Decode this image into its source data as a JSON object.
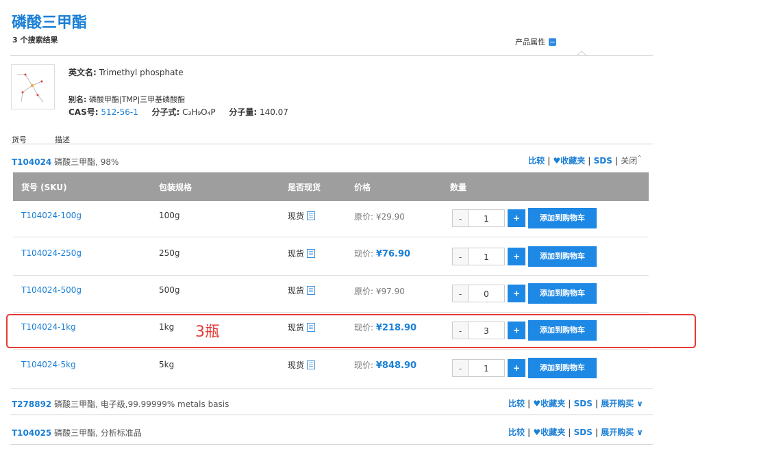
{
  "header": {
    "title": "磷酸三甲酯",
    "result_count": "3 个搜索结果",
    "attr_toggle_label": "产品属性"
  },
  "compound": {
    "english_label": "英文名:",
    "english_name": "Trimethyl phosphate",
    "alias_label": "别名:",
    "alias": "磷酸甲酯|TMP|三甲基磷酸酯",
    "cas_label": "CAS号:",
    "cas": "512-56-1",
    "formula_label": "分子式:",
    "formula": "C₃H₉O₄P",
    "mw_label": "分子量:",
    "mw": "140.07"
  },
  "list_header": {
    "sku": "货号",
    "desc": "描述"
  },
  "products": [
    {
      "code": "T104024",
      "desc": "磷酸三甲酯, 98%",
      "compare": "比较",
      "favorite": "收藏夹",
      "sds": "SDS",
      "toggle": "关闭"
    },
    {
      "code": "T278892",
      "desc": "磷酸三甲酯, 电子级,99.99999% metals basis",
      "compare": "比较",
      "favorite": "收藏夹",
      "sds": "SDS",
      "toggle": "展开购买"
    },
    {
      "code": "T104025",
      "desc": "磷酸三甲酯, 分析标准品",
      "compare": "比较",
      "favorite": "收藏夹",
      "sds": "SDS",
      "toggle": "展开购买"
    }
  ],
  "sku_table": {
    "columns": [
      "货号 (SKU)",
      "包装规格",
      "是否现货",
      "价格",
      "数量"
    ],
    "rows": [
      {
        "sku": "T104024-100g",
        "spec": "100g",
        "stock": "现货",
        "price_label": "原价:",
        "price": "¥29.90",
        "qty": "1",
        "cart": "添加到购物车"
      },
      {
        "sku": "T104024-250g",
        "spec": "250g",
        "stock": "现货",
        "price_label": "现价:",
        "price": "¥76.90",
        "qty": "1",
        "cart": "添加到购物车"
      },
      {
        "sku": "T104024-500g",
        "spec": "500g",
        "stock": "现货",
        "price_label": "原价:",
        "price": "¥97.90",
        "qty": "0",
        "cart": "添加到购物车"
      },
      {
        "sku": "T104024-1kg",
        "spec": "1kg",
        "stock": "现货",
        "price_label": "现价:",
        "price": "¥218.90",
        "qty": "3",
        "cart": "添加到购物车"
      },
      {
        "sku": "T104024-5kg",
        "spec": "5kg",
        "stock": "现货",
        "price_label": "现价:",
        "price": "¥848.90",
        "qty": "1",
        "cart": "添加到购物车"
      }
    ]
  },
  "annotation": {
    "text": "3瓶",
    "color": "#e53935"
  },
  "colors": {
    "accent": "#1a7fd6",
    "table_header": "#9e9e9e",
    "cart_button": "#1e88e5"
  }
}
